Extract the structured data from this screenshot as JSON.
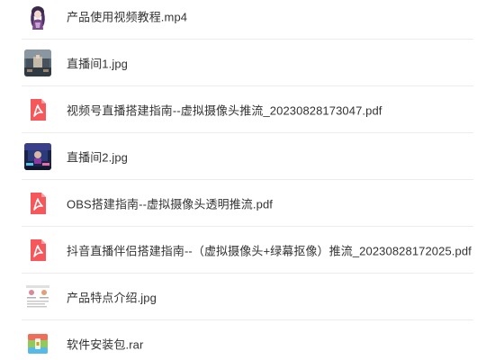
{
  "files": [
    {
      "name": "产品使用视频教程.mp4",
      "icon": "video-thumbnail-icon",
      "type": "mp4"
    },
    {
      "name": "直播间1.jpg",
      "icon": "image-thumbnail-icon",
      "type": "jpg"
    },
    {
      "name": "视频号直播搭建指南--虚拟摄像头推流_20230828173047.pdf",
      "icon": "pdf-icon",
      "type": "pdf"
    },
    {
      "name": "直播间2.jpg",
      "icon": "image-thumbnail-icon",
      "type": "jpg"
    },
    {
      "name": "OBS搭建指南--虚拟摄像头透明推流.pdf",
      "icon": "pdf-icon",
      "type": "pdf"
    },
    {
      "name": "抖音直播伴侣搭建指南--（虚拟摄像头+绿幕抠像）推流_20230828172025.pdf",
      "icon": "pdf-icon",
      "type": "pdf"
    },
    {
      "name": "产品特点介绍.jpg",
      "icon": "image-thumbnail-icon",
      "type": "jpg"
    },
    {
      "name": "软件安装包.rar",
      "icon": "archive-icon",
      "type": "rar"
    }
  ],
  "colors": {
    "pdf_icon": "#f5575a",
    "text": "#333333",
    "separator": "#ececec"
  }
}
